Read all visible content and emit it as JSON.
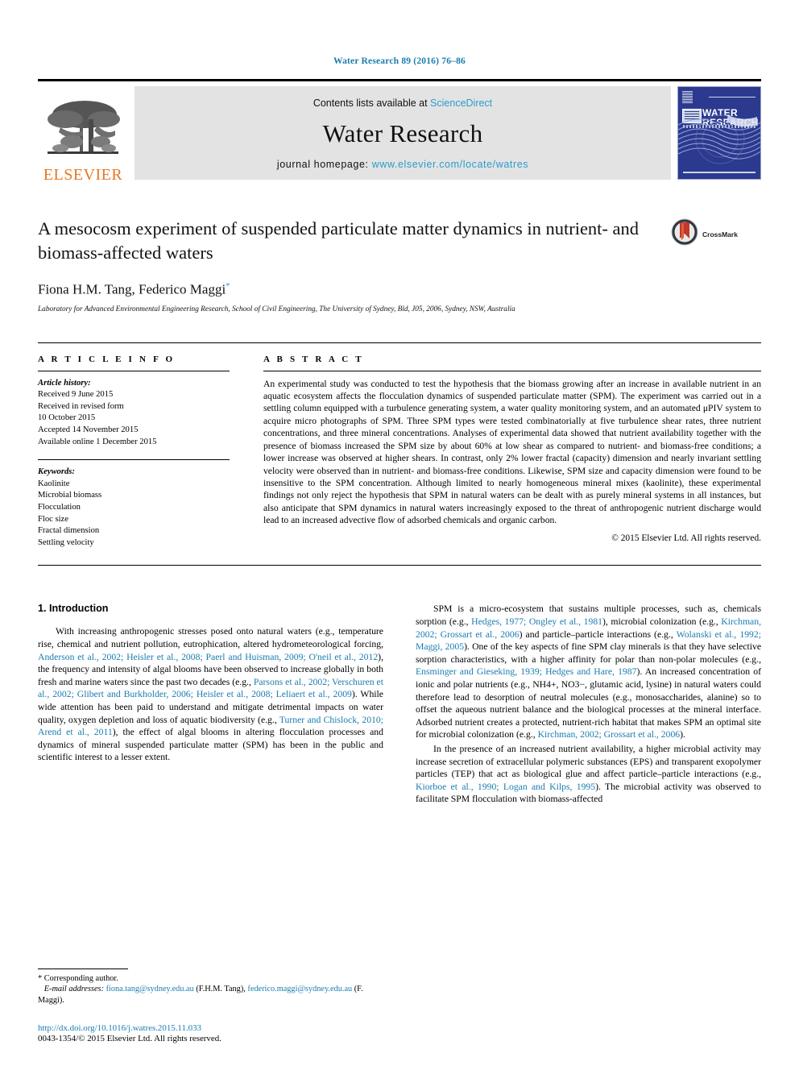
{
  "running_head": "Water Research 89 (2016) 76–86",
  "masthead": {
    "publisher_name": "ELSEVIER",
    "contents_prefix": "Contents lists available at ",
    "contents_link": "ScienceDirect",
    "journal_title": "Water Research",
    "homepage_prefix": "journal homepage: ",
    "homepage_url": "www.elsevier.com/locate/watres",
    "cover_title_line1": "WATER",
    "cover_title_line2": "RESEARCH"
  },
  "article": {
    "title": "A mesocosm experiment of suspended particulate matter dynamics in nutrient- and biomass-affected waters",
    "authors": "Fiona H.M. Tang, Federico Maggi",
    "corresponding_marker": "*",
    "affiliation": "Laboratory for Advanced Environmental Engineering Research, School of Civil Engineering, The University of Sydney, Bld, J05, 2006, Sydney, NSW, Australia",
    "crossmark_label": "CrossMark"
  },
  "article_info": {
    "heading": "A R T I C L E  I N F O",
    "history_label": "Article history:",
    "history": [
      "Received 9 June 2015",
      "Received in revised form",
      "10 October 2015",
      "Accepted 14 November 2015",
      "Available online 1 December 2015"
    ],
    "keywords_label": "Keywords:",
    "keywords": [
      "Kaolinite",
      "Microbial biomass",
      "Flocculation",
      "Floc size",
      "Fractal dimension",
      "Settling velocity"
    ]
  },
  "abstract": {
    "heading": "A B S T R A C T",
    "text": "An experimental study was conducted to test the hypothesis that the biomass growing after an increase in available nutrient in an aquatic ecosystem affects the flocculation dynamics of suspended particulate matter (SPM). The experiment was carried out in a settling column equipped with a turbulence generating system, a water quality monitoring system, and an automated μPIV system to acquire micro photographs of SPM. Three SPM types were tested combinatorially at five turbulence shear rates, three nutrient concentrations, and three mineral concentrations. Analyses of experimental data showed that nutrient availability together with the presence of biomass increased the SPM size by about 60% at low shear as compared to nutrient- and biomass-free conditions; a lower increase was observed at higher shears. In contrast, only 2% lower fractal (capacity) dimension and nearly invariant settling velocity were observed than in nutrient- and biomass-free conditions. Likewise, SPM size and capacity dimension were found to be insensitive to the SPM concentration. Although limited to nearly homogeneous mineral mixes (kaolinite), these experimental findings not only reject the hypothesis that SPM in natural waters can be dealt with as purely mineral systems in all instances, but also anticipate that SPM dynamics in natural waters increasingly exposed to the threat of anthropogenic nutrient discharge would lead to an increased advective flow of adsorbed chemicals and organic carbon.",
    "copyright": "© 2015 Elsevier Ltd. All rights reserved."
  },
  "body": {
    "section_heading": "1. Introduction",
    "left_paragraphs": [
      {
        "runs": [
          {
            "t": "With increasing anthropogenic stresses posed onto natural waters (e.g., temperature rise, chemical and nutrient pollution, eutrophication, altered hydrometeorological forcing, "
          },
          {
            "t": "Anderson et al., 2002; Heisler et al., 2008; Paerl and Huisman, 2009; O'neil et al., 2012",
            "c": true
          },
          {
            "t": "), the frequency and intensity of algal blooms have been observed to increase globally in both fresh and marine waters since the past two decades (e.g., "
          },
          {
            "t": "Parsons et al., 2002; Verschuren et al., 2002; Glibert and Burkholder, 2006; Heisler et al., 2008; Leliaert et al., 2009",
            "c": true
          },
          {
            "t": "). While wide attention has been paid to understand and mitigate detrimental impacts on water quality, oxygen depletion and loss of aquatic biodiversity (e.g., "
          },
          {
            "t": "Turner and Chislock, 2010; Arend et al., 2011",
            "c": true
          },
          {
            "t": "), the effect of algal blooms in altering flocculation processes and dynamics of mineral suspended particulate matter (SPM) has been in the public and scientific interest to a lesser extent."
          }
        ]
      }
    ],
    "right_paragraphs": [
      {
        "runs": [
          {
            "t": "SPM is a micro-ecosystem that sustains multiple processes, such as, chemicals sorption (e.g., "
          },
          {
            "t": "Hedges, 1977; Ongley et al., 1981",
            "c": true
          },
          {
            "t": "), microbial colonization (e.g., "
          },
          {
            "t": "Kirchman, 2002; Grossart et al., 2006",
            "c": true
          },
          {
            "t": ") and particle–particle interactions (e.g., "
          },
          {
            "t": "Wolanski et al., 1992; Maggi, 2005",
            "c": true
          },
          {
            "t": "). One of the key aspects of fine SPM clay minerals is that they have selective sorption characteristics, with a higher affinity for polar than non-polar molecules (e.g., "
          },
          {
            "t": "Ensminger and Gieseking, 1939; Hedges and Hare, 1987",
            "c": true
          },
          {
            "t": "). An increased concentration of ionic and polar nutrients (e.g., NH4+, NO3−, glutamic acid, lysine) in natural waters could therefore lead to desorption of neutral molecules (e.g., monosaccharides, alanine) so to offset the aqueous nutrient balance and the biological processes at the mineral interface. Adsorbed nutrient creates a protected, nutrient-rich habitat that makes SPM an optimal site for microbial colonization (e.g., "
          },
          {
            "t": "Kirchman, 2002; Grossart et al., 2006",
            "c": true
          },
          {
            "t": ")."
          }
        ]
      },
      {
        "runs": [
          {
            "t": "In the presence of an increased nutrient availability, a higher microbial activity may increase secretion of extracellular polymeric substances (EPS) and transparent exopolymer particles (TEP) that act as biological glue and affect particle–particle interactions (e.g., "
          },
          {
            "t": "Kiorboe et al., 1990; Logan and Kilps, 1995",
            "c": true
          },
          {
            "t": "). The microbial activity was observed to facilitate SPM flocculation with biomass-affected"
          }
        ]
      }
    ]
  },
  "footnotes": {
    "corresponding": "* Corresponding author.",
    "email_label": "E-mail addresses:",
    "email1": "fiona.tang@sydney.edu.au",
    "email1_owner": "(F.H.M. Tang),",
    "email2": "federico.maggi@sydney.edu.au",
    "email2_owner": "(F. Maggi).",
    "doi": "http://dx.doi.org/10.1016/j.watres.2015.11.033",
    "issn": "0043-1354/© 2015 Elsevier Ltd. All rights reserved."
  },
  "colors": {
    "link": "#1a7cb0",
    "sciencedirect": "#2b9ccc",
    "elsevier_orange": "#E87722",
    "cover_blue": "#2b3a8f"
  }
}
